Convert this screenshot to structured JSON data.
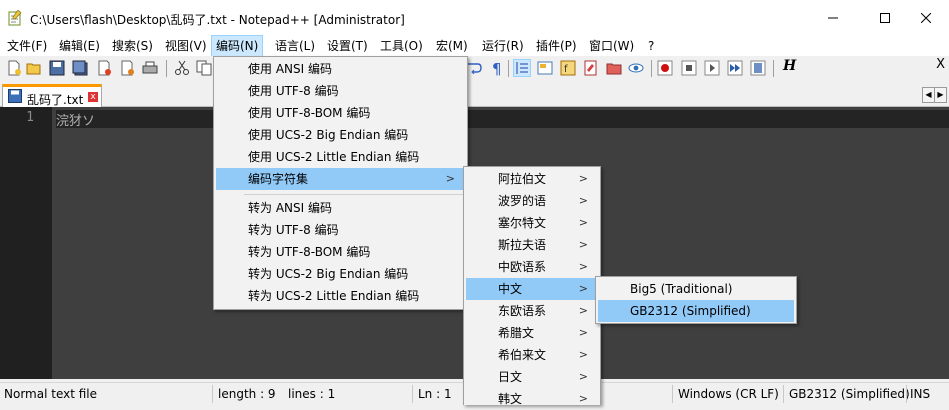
{
  "window": {
    "title": "C:\\Users\\flash\\Desktop\\乱码了.txt - Notepad++ [Administrator]",
    "minimize_label": "─",
    "maximize_label": "☐",
    "close_label": "✕"
  },
  "menubar": [
    {
      "label": "文件(F)"
    },
    {
      "label": "编辑(E)"
    },
    {
      "label": "搜索(S)"
    },
    {
      "label": "视图(V)"
    },
    {
      "label": "编码(N)"
    },
    {
      "label": "语言(L)"
    },
    {
      "label": "设置(T)"
    },
    {
      "label": "工具(O)"
    },
    {
      "label": "宏(M)"
    },
    {
      "label": "运行(R)"
    },
    {
      "label": "插件(P)"
    },
    {
      "label": "窗口(W)"
    },
    {
      "label": "?"
    }
  ],
  "toolbar": {
    "close_x": "X",
    "macro_icon_label": "H"
  },
  "tab": {
    "label": "乱码了.txt",
    "close_label": "x"
  },
  "editor": {
    "line_number": "1",
    "line_text": "浣犲ソ"
  },
  "encoding_menu": [
    {
      "label": "使用 ANSI 编码"
    },
    {
      "label": "使用 UTF-8 编码"
    },
    {
      "label": "使用 UTF-8-BOM 编码"
    },
    {
      "label": "使用 UCS-2 Big Endian 编码"
    },
    {
      "label": "使用 UCS-2 Little Endian 编码"
    },
    {
      "label": "编码字符集"
    },
    {
      "label": "转为 ANSI 编码"
    },
    {
      "label": "转为 UTF-8 编码"
    },
    {
      "label": "转为 UTF-8-BOM 编码"
    },
    {
      "label": "转为 UCS-2 Big Endian 编码"
    },
    {
      "label": "转为 UCS-2 Little Endian 编码"
    }
  ],
  "charset_menu": [
    {
      "label": "阿拉伯文"
    },
    {
      "label": "波罗的语"
    },
    {
      "label": "塞尔特文"
    },
    {
      "label": "斯拉夫语"
    },
    {
      "label": "中欧语系"
    },
    {
      "label": "中文"
    },
    {
      "label": "东欧语系"
    },
    {
      "label": "希腊文"
    },
    {
      "label": "希伯来文"
    },
    {
      "label": "日文"
    },
    {
      "label": "韩文"
    }
  ],
  "chinese_menu": [
    {
      "label": "Big5 (Traditional)"
    },
    {
      "label": "GB2312 (Simplified)"
    }
  ],
  "submenu_arrow": ">",
  "statusbar": {
    "file_type": "Normal text file",
    "length": "length : 9",
    "lines": "lines : 1",
    "ln": "Ln : 1",
    "eol": "Windows (CR LF)",
    "encoding": "GB2312 (Simplified)",
    "mode": "INS"
  },
  "colors": {
    "highlight": "#91c9f7",
    "menu_active": "#cce8ff",
    "editor_bg": "#3f3f3f",
    "tab_accent": "#fa9a00"
  }
}
